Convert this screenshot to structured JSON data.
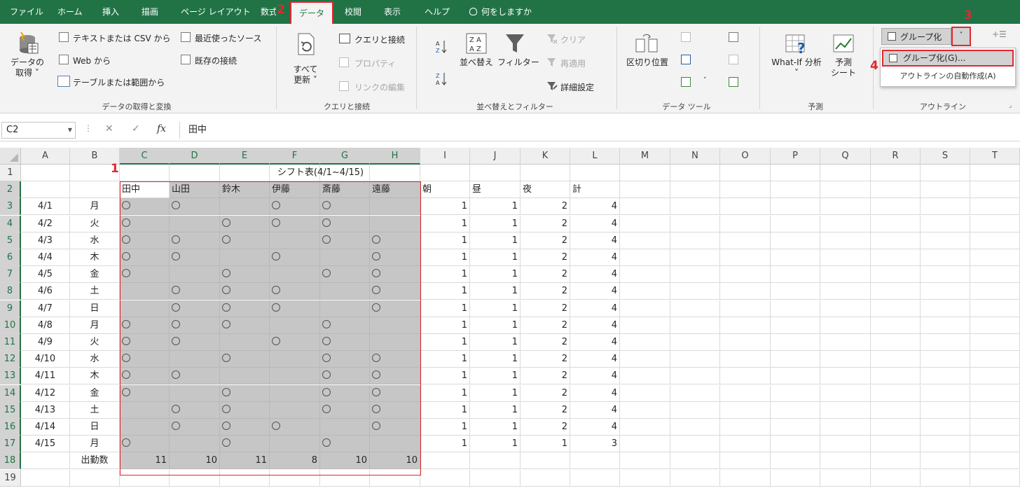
{
  "tabs": [
    "ファイル",
    "ホーム",
    "挿入",
    "描画",
    "ページ レイアウト",
    "数式",
    "データ",
    "校閲",
    "表示",
    "ヘルプ",
    "何をしますか"
  ],
  "ribbon": {
    "get_data": {
      "group_label": "データの取得と変換",
      "get_data_btn": "データの\n取得 ˅",
      "text_csv": "テキストまたは CSV から",
      "web": "Web から",
      "table_range": "テーブルまたは範囲から",
      "recent_sources": "最近使ったソース",
      "existing_conn": "既存の接続"
    },
    "queries": {
      "group_label": "クエリと接続",
      "refresh_all": "すべて\n更新 ˅",
      "queries_conn": "クエリと接続",
      "properties": "プロパティ",
      "edit_links": "リンクの編集"
    },
    "sort_filter": {
      "group_label": "並べ替えとフィルター",
      "sort": "並べ替え",
      "filter": "フィルター",
      "clear": "クリア",
      "reapply": "再適用",
      "advanced": "詳細設定"
    },
    "data_tools": {
      "group_label": "データ ツール",
      "text_to_columns": "区切り位置"
    },
    "forecast": {
      "group_label": "予測",
      "what_if": "What-If 分析\n˅",
      "forecast_sheet": "予測\nシート"
    },
    "outline": {
      "group_label": "アウトライン",
      "group_btn": "グループ化",
      "dropdown_item_1": "グループ化(G)...",
      "dropdown_item_2": "アウトラインの自動作成(A)"
    }
  },
  "steps": [
    "1",
    "2",
    "3",
    "4"
  ],
  "formula_bar": {
    "name_box": "C2",
    "fx": "fx",
    "content": "田中"
  },
  "sheet": {
    "columns": [
      "A",
      "B",
      "C",
      "D",
      "E",
      "F",
      "G",
      "H",
      "I",
      "J",
      "K",
      "L",
      "M",
      "N",
      "O",
      "P",
      "Q",
      "R",
      "S",
      "T"
    ],
    "rows": [
      "1",
      "2",
      "3",
      "4",
      "5",
      "6",
      "7",
      "8",
      "9",
      "10",
      "11",
      "12",
      "13",
      "14",
      "15",
      "16",
      "17",
      "18",
      "19"
    ],
    "title": "シフト表(4/1~4/15)",
    "header_row": [
      "田中",
      "山田",
      "鈴木",
      "伊藤",
      "斎藤",
      "遠藤",
      "朝",
      "昼",
      "夜",
      "計"
    ],
    "dates": [
      "4/1",
      "4/2",
      "4/3",
      "4/4",
      "4/5",
      "4/6",
      "4/7",
      "4/8",
      "4/9",
      "4/10",
      "4/11",
      "4/12",
      "4/13",
      "4/14",
      "4/15"
    ],
    "weekdays": [
      "月",
      "火",
      "水",
      "木",
      "金",
      "土",
      "日",
      "月",
      "火",
      "水",
      "木",
      "金",
      "土",
      "日",
      "月"
    ],
    "marks": [
      [
        1,
        1,
        0,
        1,
        1,
        0
      ],
      [
        1,
        0,
        1,
        1,
        1,
        0
      ],
      [
        1,
        1,
        1,
        0,
        1,
        1
      ],
      [
        1,
        1,
        0,
        1,
        0,
        1
      ],
      [
        1,
        0,
        1,
        0,
        1,
        1
      ],
      [
        0,
        1,
        1,
        1,
        0,
        1
      ],
      [
        0,
        1,
        1,
        1,
        0,
        1
      ],
      [
        1,
        1,
        1,
        0,
        1,
        0
      ],
      [
        1,
        1,
        0,
        1,
        1,
        0
      ],
      [
        1,
        0,
        1,
        0,
        1,
        1
      ],
      [
        1,
        1,
        0,
        0,
        1,
        1
      ],
      [
        1,
        0,
        1,
        0,
        1,
        1
      ],
      [
        0,
        1,
        1,
        0,
        1,
        1
      ],
      [
        0,
        1,
        1,
        1,
        0,
        1
      ],
      [
        1,
        0,
        1,
        0,
        1,
        0
      ]
    ],
    "shift_counts": [
      [
        1,
        1,
        2,
        4
      ],
      [
        1,
        1,
        2,
        4
      ],
      [
        1,
        1,
        2,
        4
      ],
      [
        1,
        1,
        2,
        4
      ],
      [
        1,
        1,
        2,
        4
      ],
      [
        1,
        1,
        2,
        4
      ],
      [
        1,
        1,
        2,
        4
      ],
      [
        1,
        1,
        2,
        4
      ],
      [
        1,
        1,
        2,
        4
      ],
      [
        1,
        1,
        2,
        4
      ],
      [
        1,
        1,
        2,
        4
      ],
      [
        1,
        1,
        2,
        4
      ],
      [
        1,
        1,
        2,
        4
      ],
      [
        1,
        1,
        2,
        4
      ],
      [
        1,
        1,
        1,
        3
      ]
    ],
    "attendance_label": "出勤数",
    "attendance": [
      11,
      10,
      11,
      8,
      10,
      10
    ]
  }
}
